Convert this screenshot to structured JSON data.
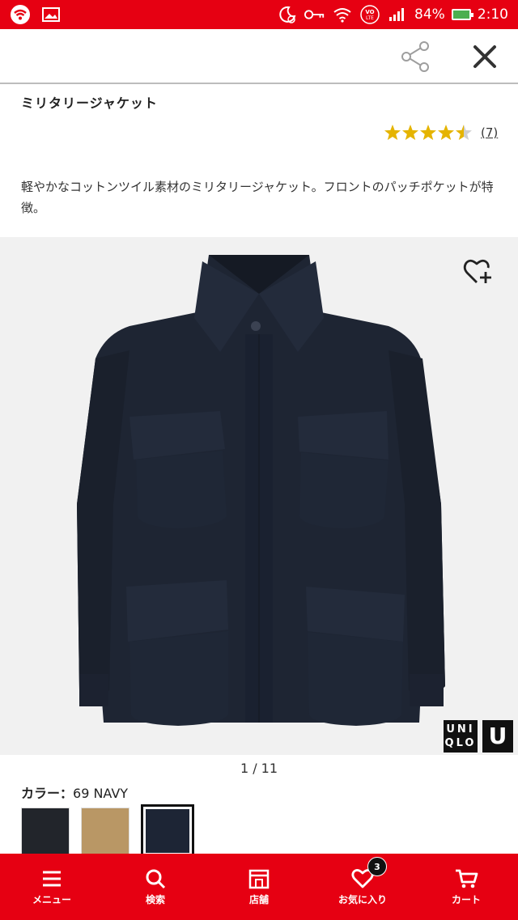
{
  "status_bar": {
    "battery": "84%",
    "time": "2:10",
    "icons": [
      "wifi-icon",
      "image-icon",
      "alarm-icon",
      "key-icon",
      "wifi-signal-icon",
      "volte-icon",
      "cellular-signal-icon",
      "battery-icon"
    ]
  },
  "header": {
    "share_icon": "share-icon",
    "close_icon": "close-icon"
  },
  "product": {
    "title": "ミリタリージャケット",
    "rating": 4.5,
    "review_count": "(7)",
    "description": "軽やかなコットンツイル素材のミリタリージャケット。フロントのパッチポケットが特徴。",
    "image_pager": "1 / 11",
    "favorite_icon": "heart-plus-icon",
    "brand_logo_text": "UNI QLO",
    "brand_logo_u": "U",
    "color_label": "カラー：",
    "color_value": "69 NAVY",
    "swatches": [
      {
        "name": "black",
        "color": "#22252b",
        "selected": false
      },
      {
        "name": "beige",
        "color": "#b99765",
        "selected": false
      },
      {
        "name": "navy",
        "color": "#1d2535",
        "selected": true
      }
    ]
  },
  "bottom_nav": {
    "items": [
      {
        "label": "メニュー",
        "icon": "menu-icon"
      },
      {
        "label": "検索",
        "icon": "search-icon"
      },
      {
        "label": "店舗",
        "icon": "store-icon"
      },
      {
        "label": "お気に入り",
        "icon": "heart-icon",
        "badge": "3"
      },
      {
        "label": "カート",
        "icon": "cart-icon"
      }
    ]
  },
  "colors": {
    "brand_red": "#e60012",
    "star": "#e5b400"
  }
}
